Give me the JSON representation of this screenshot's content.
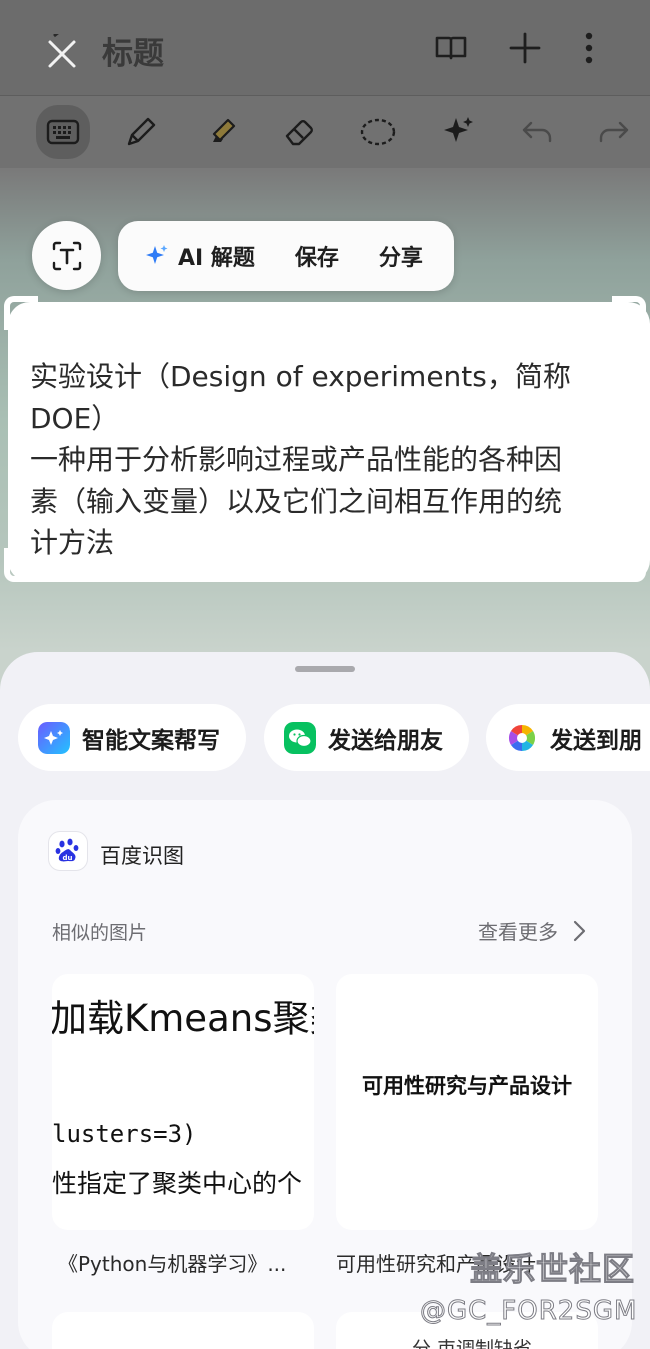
{
  "header": {
    "title": "标题"
  },
  "selection_actions": {
    "ai_solve_label": "AI 解题",
    "save_label": "保存",
    "share_label": "分享"
  },
  "recognized_text": {
    "line1": "实验设计（Design of experiments，简称",
    "line2": "DOE）",
    "line3": "一种用于分析影响过程或产品性能的各种因",
    "line4": "素（输入变量）以及它们之间相互作用的统",
    "line5": "计方法"
  },
  "quick_actions": [
    {
      "label": "智能文案帮写",
      "icon": "ai-writing-icon"
    },
    {
      "label": "发送给朋友",
      "icon": "wechat-icon"
    },
    {
      "label": "发送到朋",
      "icon": "moments-icon"
    }
  ],
  "baidu": {
    "title": "百度识图",
    "similar_label": "相似的图片",
    "see_more_label": "查看更多",
    "results": [
      {
        "line1": "加载Kmeans聚类",
        "line2": "lusters=3)",
        "line3": "性指定了聚类中心的个",
        "caption": "《Python与机器学习》..."
      },
      {
        "line1": "可用性研究与产品设计",
        "caption": "可用性研究和产品设计"
      }
    ],
    "partial_result_text": "分 束调制缺省"
  },
  "watermark": {
    "line1": "盖乐世社区",
    "line2": "@GC_FOR2SGM"
  },
  "colors": {
    "accent_blue": "#2f7cf6",
    "wechat_green": "#07c160"
  }
}
